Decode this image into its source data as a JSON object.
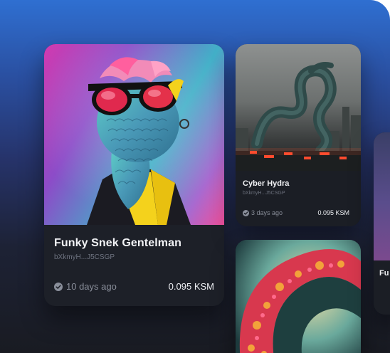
{
  "cards": [
    {
      "title": "Funky Snek Gentelman",
      "address": "bXkmyH...J5CSGP",
      "time": "10 days ago",
      "price": "0.095 KSM"
    },
    {
      "title": "Cyber Hydra",
      "address": "bXkmyH...J5CSGP",
      "time": "3 days ago",
      "price": "0.095 KSM"
    },
    {
      "title": "Fu",
      "address": ""
    }
  ],
  "icons": {
    "time": "check-circle-icon"
  },
  "colors": {
    "background_top": "#2f6fd1",
    "background_bottom": "#191b22",
    "card": "#1d2028",
    "title_text": "#f2f3f6",
    "muted_text": "#8a8f9b"
  }
}
